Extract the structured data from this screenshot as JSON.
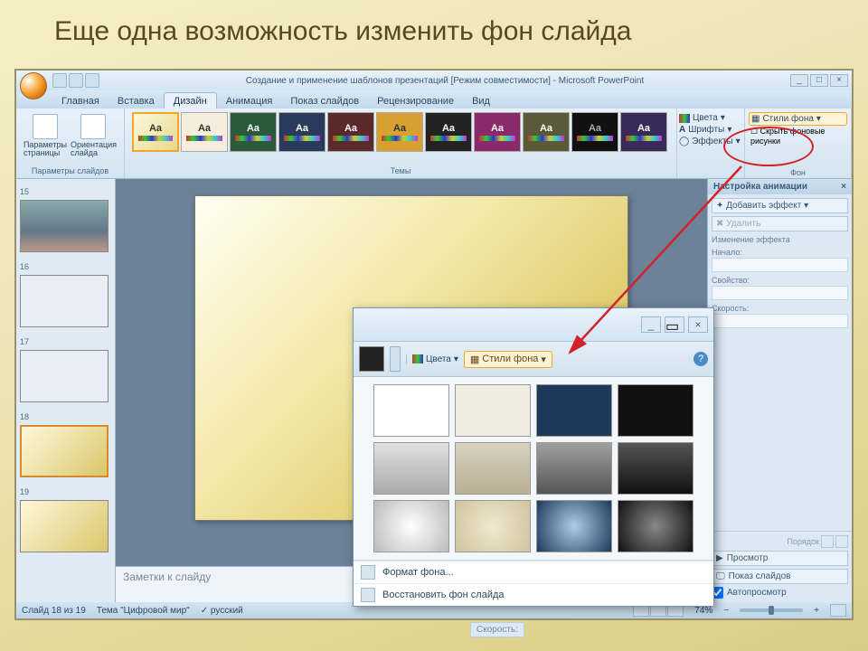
{
  "page": {
    "title": "Еще одна возможность изменить фон слайда"
  },
  "titlebar": {
    "text": "Создание и применение шаблонов презентаций [Режим совместимости] - Microsoft PowerPoint",
    "minimize": "_",
    "maximize": "□",
    "close": "×"
  },
  "tabs": {
    "items": [
      "Главная",
      "Вставка",
      "Дизайн",
      "Анимация",
      "Показ слайдов",
      "Рецензирование",
      "Вид"
    ],
    "active_index": 2
  },
  "ribbon": {
    "page_setup": {
      "label": "Параметры слайдов",
      "btn1": "Параметры\nстраницы",
      "btn2": "Ориентация\nслайда"
    },
    "themes": {
      "label": "Темы",
      "aa": "Aa"
    },
    "theme_colors": {
      "colors": "Цвета",
      "fonts": "Шрифты",
      "effects": "Эффекты"
    },
    "background": {
      "styles": "Стили фона",
      "hide": "Скрыть фоновые рисунки",
      "label": "Фон"
    }
  },
  "thumbs": {
    "n15": "15",
    "n16": "16",
    "n17": "17",
    "n18": "18",
    "n19": "19"
  },
  "notes": {
    "placeholder": "Заметки к слайду"
  },
  "anim_pane": {
    "title": "Настройка анимации",
    "add": "Добавить эффект",
    "remove": "Удалить",
    "change": "Изменение эффекта",
    "start": "Начало:",
    "property": "Свойство:",
    "speed": "Скорость:",
    "order": "Порядок",
    "preview": "Просмотр",
    "show": "Показ слайдов",
    "auto": "Автопросмотр"
  },
  "status": {
    "slide": "Слайд 18 из 19",
    "theme": "Тема \"Цифровой мир\"",
    "lang": "русский",
    "zoom": "74%"
  },
  "popup": {
    "minimize": "_",
    "close": "×",
    "colors": "Цвета",
    "styles": "Стили фона",
    "format": "Формат фона...",
    "restore": "Восстановить фон слайда"
  },
  "below_peek": {
    "label": "Скорость:"
  }
}
